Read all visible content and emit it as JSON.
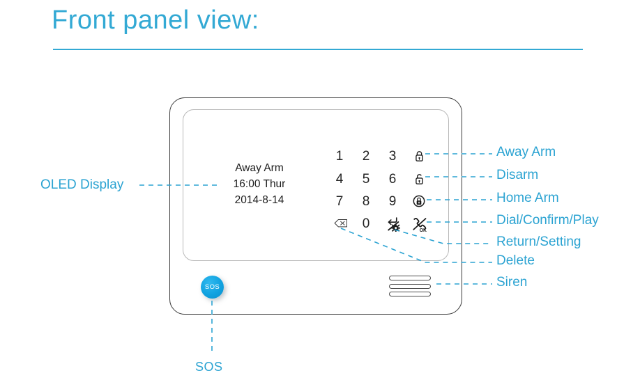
{
  "header": {
    "title": "Front panel view:",
    "accent_color": "#33A9D4",
    "rule_color": "#33A9D4"
  },
  "device": {
    "outline_color": "#3a3a3a",
    "inner_outline_color": "#b8b8b8",
    "oled": {
      "line1": "Away Arm",
      "line2": "16:00 Thur",
      "line3": "2014-8-14",
      "text_color": "#1d1d1d"
    },
    "keypad": {
      "rows": [
        [
          {
            "type": "digit",
            "label": "1",
            "name": "key-1"
          },
          {
            "type": "digit",
            "label": "2",
            "name": "key-2"
          },
          {
            "type": "digit",
            "label": "3",
            "name": "key-3"
          },
          {
            "type": "icon",
            "label": "",
            "icon": "closed-padlock-icon",
            "name": "key-away-arm"
          }
        ],
        [
          {
            "type": "digit",
            "label": "4",
            "name": "key-4"
          },
          {
            "type": "digit",
            "label": "5",
            "name": "key-5"
          },
          {
            "type": "digit",
            "label": "6",
            "name": "key-6"
          },
          {
            "type": "icon",
            "label": "",
            "icon": "open-padlock-icon",
            "name": "key-disarm"
          }
        ],
        [
          {
            "type": "digit",
            "label": "7",
            "name": "key-7"
          },
          {
            "type": "digit",
            "label": "8",
            "name": "key-8"
          },
          {
            "type": "digit",
            "label": "9",
            "name": "key-9"
          },
          {
            "type": "icon",
            "label": "",
            "icon": "home-lock-icon",
            "name": "key-home-arm"
          }
        ],
        [
          {
            "type": "icon",
            "label": "",
            "icon": "backspace-delete-icon",
            "name": "key-delete"
          },
          {
            "type": "digit",
            "label": "0",
            "name": "key-0"
          },
          {
            "type": "icon",
            "label": "",
            "icon": "return-setting-gear-icon",
            "name": "key-return-setting"
          },
          {
            "type": "icon",
            "label": "",
            "icon": "phone-ok-icon",
            "name": "key-dial-confirm-play"
          }
        ]
      ]
    },
    "sos_button": {
      "label": "SOS",
      "color": "#11a2e0",
      "text_color": "#ffffff"
    },
    "siren": {
      "slot_count": 3,
      "slot_color": "#4a4a4a"
    }
  },
  "callouts": {
    "left": {
      "label": "OLED Display"
    },
    "bottom": {
      "label": "SOS"
    },
    "right": [
      {
        "label": "Away Arm",
        "name": "callout-away-arm"
      },
      {
        "label": "Disarm",
        "name": "callout-disarm"
      },
      {
        "label": "Home Arm",
        "name": "callout-home-arm"
      },
      {
        "label": "Dial/Confirm/Play",
        "name": "callout-dial-confirm-play"
      },
      {
        "label": "Return/Setting",
        "name": "callout-return-setting"
      },
      {
        "label": "Delete",
        "name": "callout-delete"
      },
      {
        "label": "Siren",
        "name": "callout-siren"
      }
    ],
    "line_color": "#2BA3D2"
  }
}
